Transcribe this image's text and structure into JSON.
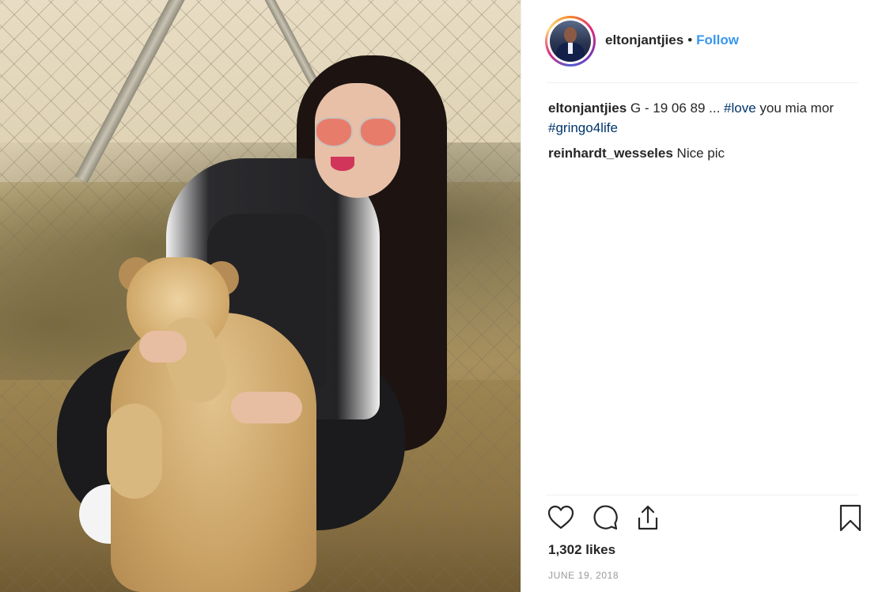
{
  "post": {
    "username": "eltonjantjies",
    "follow_label": "Follow",
    "separator": "•",
    "caption": {
      "user": "eltonjantjies",
      "text_1": "G - 19 06 89 ... ",
      "tag_1": "#love",
      "text_2": " you mia mor ",
      "tag_2": "#gringo4life"
    },
    "comments": [
      {
        "user": "reinhardt_wesseles",
        "text": "Nice pic"
      }
    ],
    "likes": "1,302 likes",
    "date": "JUNE 19, 2018"
  },
  "icons": {
    "like": "heart-icon",
    "comment": "comment-bubble-icon",
    "share": "share-upload-icon",
    "save": "bookmark-icon"
  },
  "colors": {
    "follow_blue": "#3897f0",
    "hashtag": "#003569",
    "muted": "#999999"
  }
}
